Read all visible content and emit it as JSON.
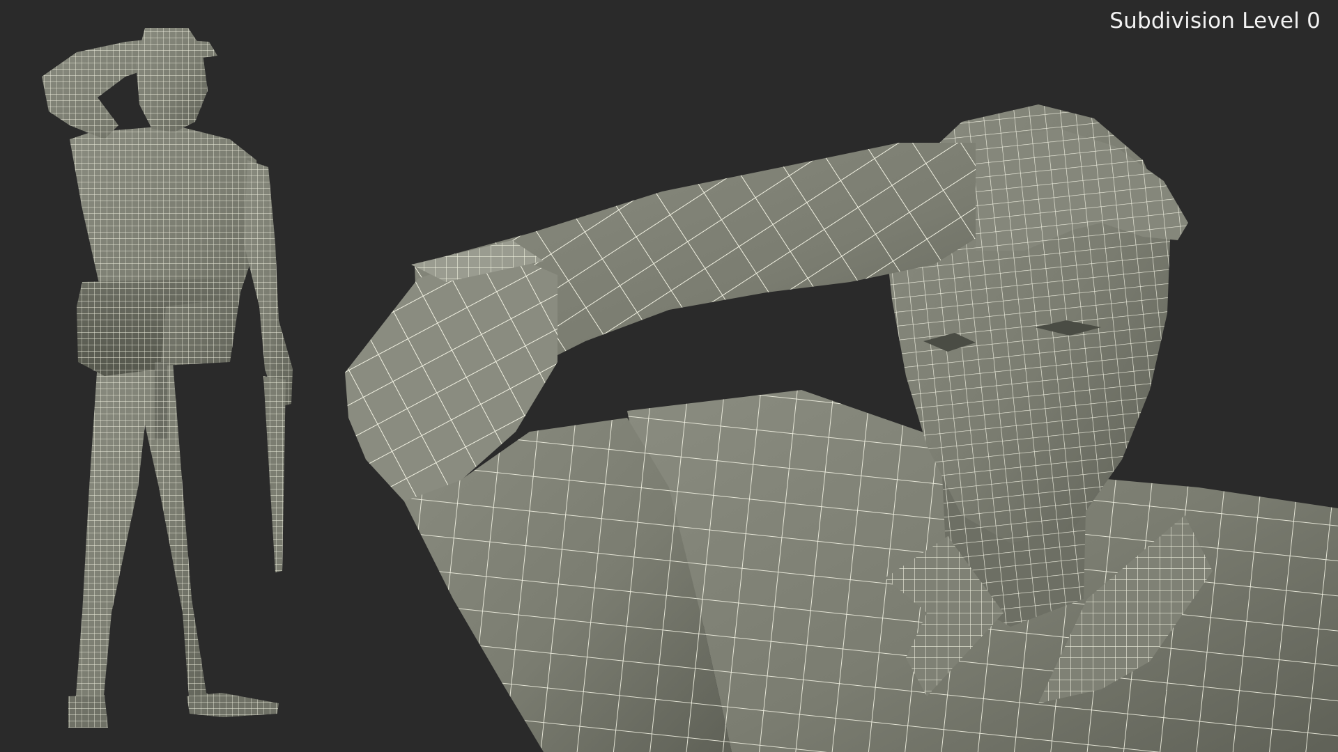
{
  "render": {
    "caption": "Subdivision Level 0",
    "background_color": "#2a2a2a",
    "surface_color": "#7d7f73",
    "wire_color": "#f3f3e6"
  }
}
